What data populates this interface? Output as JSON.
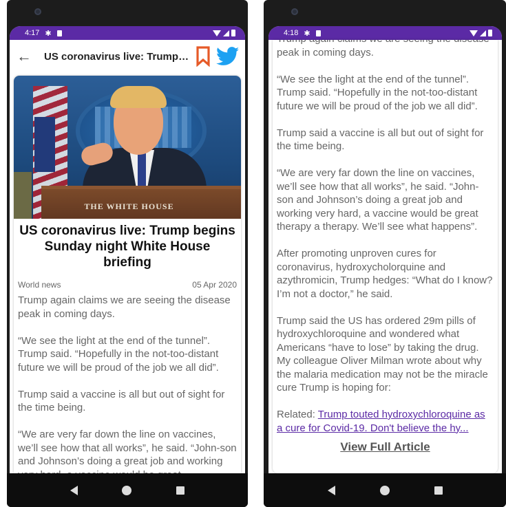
{
  "left": {
    "status": {
      "time": "4:17"
    },
    "toolbar": {
      "title": "US coronavirus live: Trump begins Sunday night White House briefing"
    },
    "hero": {
      "podium_label": "THE WHITE HOUSE"
    },
    "headline": "US coronavirus live: Trump begins Sunday night White House briefing",
    "meta": {
      "category": "World news",
      "date": "05 Apr 2020"
    },
    "paragraphs": [
      "Trump again claims we are seeing the disease peak in coming days.",
      "“We see the light at the end of the tunnel”. Trump said. “Hopefully in the not-too-distant future we will be proud of the job we all did”.",
      "Trump said a vaccine is all but out of sight for the time being.",
      "“We are very far down the line on vaccines, we’ll see how that all works”, he said. “John-son and Johnson’s doing a great job and working very hard, a vaccine would be great"
    ]
  },
  "right": {
    "status": {
      "time": "4:18"
    },
    "paragraphs": [
      "Trump again claims we are seeing the disease peak in coming days.",
      "“We see the light at the end of the tunnel”. Trump said. “Hopefully in the not-too-distant future we will be proud of the job we all did”.",
      "Trump said a vaccine is all but out of sight for the time being.",
      "“We are very far down the line on vaccines, we’ll see how that all works”, he said. “John-son and Johnson’s doing a great job and working very hard, a vaccine would be great therapy a therapy. We’ll see what happens”.",
      "After promoting unproven cures for coronavirus, hydroxycholorquine and azythromicin, Trump hedges: “What do I know? I’m not a doctor,” he said.",
      "Trump said the US has ordered 29m pills of hydroxychloroquine and wondered what Americans “have to lose” by taking the drug. My colleague Oliver Milman wrote about why the malaria medication may not be the miracle cure Trump is hoping for:"
    ],
    "related_prefix": "Related: ",
    "related_link": "Trump touted hydroxychloroquine as a cure for Covid-19. Don't believe the hy...",
    "view_full": "View Full Article"
  },
  "colors": {
    "status_bar": "#5b2aa5",
    "bookmark": "#e65a28",
    "twitter": "#1da1f2",
    "link": "#5b2aa5"
  },
  "icons": [
    "back-arrow-icon",
    "bookmark-icon",
    "twitter-icon",
    "gear-icon",
    "sim-card-icon",
    "wifi-icon",
    "signal-icon",
    "battery-icon",
    "nav-back-icon",
    "nav-home-icon",
    "nav-recents-icon"
  ]
}
